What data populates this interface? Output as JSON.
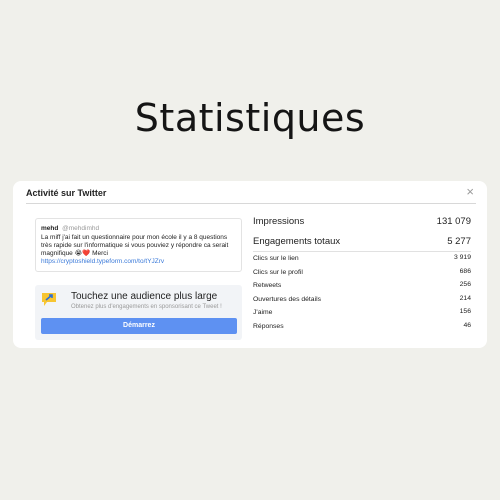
{
  "page": {
    "title": "Statistiques"
  },
  "panel": {
    "title": "Activité sur Twitter",
    "close_icon": "×"
  },
  "tweet": {
    "user": "mehd",
    "handle": "@mehdimhd",
    "text": "La miff j'ai fait un questionnaire pour mon école il y a 8 questions très rapide sur l'informatique si vous pouviez y répondre ca serait magnifique 😭❤️ Merci",
    "link": "https://cryptoshield.typeform.com/to/tYJZrv"
  },
  "promo": {
    "icon": "megaphone-icon",
    "title": "Touchez une audience plus large",
    "subtitle": "Obtenez plus d'engagements en sponsorisant ce Tweet !",
    "button_label": "Démarrez",
    "button_color": "#5e91f2"
  },
  "stats": {
    "impressions": {
      "label": "Impressions",
      "value": "131 079"
    },
    "engagements": {
      "label": "Engagements totaux",
      "value": "5 277"
    },
    "details": [
      {
        "label": "Clics sur le lien",
        "value": "3 919"
      },
      {
        "label": "Clics sur le profil",
        "value": "686"
      },
      {
        "label": "Retweets",
        "value": "256"
      },
      {
        "label": "Ouvertures des détails",
        "value": "214"
      },
      {
        "label": "J'aime",
        "value": "156"
      },
      {
        "label": "Réponses",
        "value": "46"
      }
    ]
  }
}
